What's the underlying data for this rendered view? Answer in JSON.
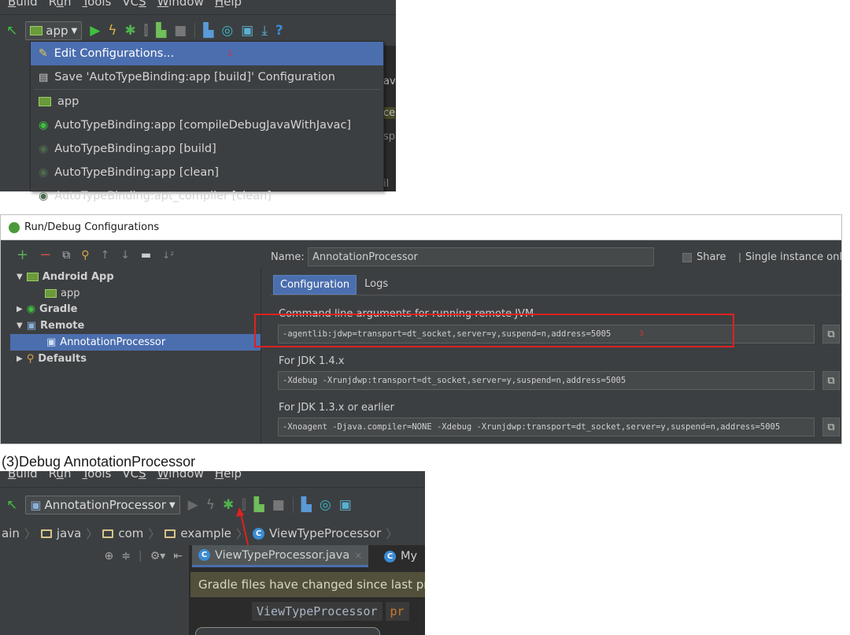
{
  "panel1": {
    "menu": [
      {
        "pre": "",
        "u": "B",
        "post": "uild"
      },
      {
        "pre": "R",
        "u": "u",
        "post": "n"
      },
      {
        "pre": "",
        "u": "T",
        "post": "ools"
      },
      {
        "pre": "VC",
        "u": "S",
        "post": ""
      },
      {
        "pre": "",
        "u": "W",
        "post": "indow"
      },
      {
        "pre": "",
        "u": "H",
        "post": "elp"
      }
    ],
    "combo_label": "app",
    "dropdown": {
      "items": [
        {
          "label": "Edit Configurations...",
          "selected": true,
          "marker": "1"
        },
        {
          "label": "Save 'AutoTypeBinding:app [build]' Configuration"
        },
        {
          "label": "app"
        },
        {
          "label": "AutoTypeBinding:app [compileDebugJavaWithJavac]"
        },
        {
          "label": "AutoTypeBinding:app [build]"
        },
        {
          "label": "AutoTypeBinding:app [clean]"
        },
        {
          "label": "AutoTypeBinding:apt_compiler [clean]"
        }
      ]
    },
    "bg_fragments": [
      "av",
      "ce",
      "sp",
      "il"
    ]
  },
  "panel2": {
    "title": "Run/Debug Configurations",
    "tree": [
      {
        "label": "Android App",
        "level": 0,
        "arrow": "▼",
        "bold": true
      },
      {
        "label": "app",
        "level": 1
      },
      {
        "label": "Gradle",
        "level": 0,
        "arrow": "▶",
        "bold": true
      },
      {
        "label": "Remote",
        "level": 0,
        "arrow": "▼",
        "bold": true
      },
      {
        "label": "AnnotationProcessor",
        "level": 1,
        "selected": true
      },
      {
        "label": "Defaults",
        "level": 0,
        "arrow": "▶",
        "bold": true
      }
    ],
    "name_label": "Name:",
    "name_value": "AnnotationProcessor",
    "share_label": "Share",
    "single_label": "Single instance only",
    "tabs": [
      "Configuration",
      "Logs"
    ],
    "cmd_label": "Command line arguments for running remote JVM",
    "cmd_value": "-agentlib:jdwp=transport=dt_socket,server=y,suspend=n,address=5005",
    "marker": "3",
    "jdk14_label": "For JDK 1.4.x",
    "jdk14_value": "-Xdebug -Xrunjdwp:transport=dt_socket,server=y,suspend=n,address=5005",
    "jdk13_label": "For JDK 1.3.x or earlier",
    "jdk13_value": "-Xnoagent -Djava.compiler=NONE -Xdebug -Xrunjdwp:transport=dt_socket,server=y,suspend=n,address=5005"
  },
  "caption": "(3)Debug AnnotationProcessor",
  "panel3": {
    "menu": [
      {
        "pre": "",
        "u": "B",
        "post": "uild"
      },
      {
        "pre": "R",
        "u": "u",
        "post": "n"
      },
      {
        "pre": "",
        "u": "T",
        "post": "ools"
      },
      {
        "pre": "VC",
        "u": "S",
        "post": ""
      },
      {
        "pre": "",
        "u": "W",
        "post": "indow"
      },
      {
        "pre": "",
        "u": "H",
        "post": "elp"
      }
    ],
    "combo_label": "AnnotationProcessor",
    "breadcrumb": [
      "ain",
      "java",
      "com",
      "example",
      "ViewTypeProcessor"
    ],
    "editor_tab": "ViewTypeProcessor.java",
    "editor_tab2": "My",
    "gradle_msg": "Gradle files have changed since last pr",
    "code_class": "ViewTypeProcessor",
    "code_kw": "pr"
  },
  "colors": {
    "ide_bg": "#3c3f41",
    "editor_bg": "#2b2b2b",
    "selection": "#4b6eaf",
    "run_green": "#3fbf3f",
    "red_mark": "#e03030"
  }
}
